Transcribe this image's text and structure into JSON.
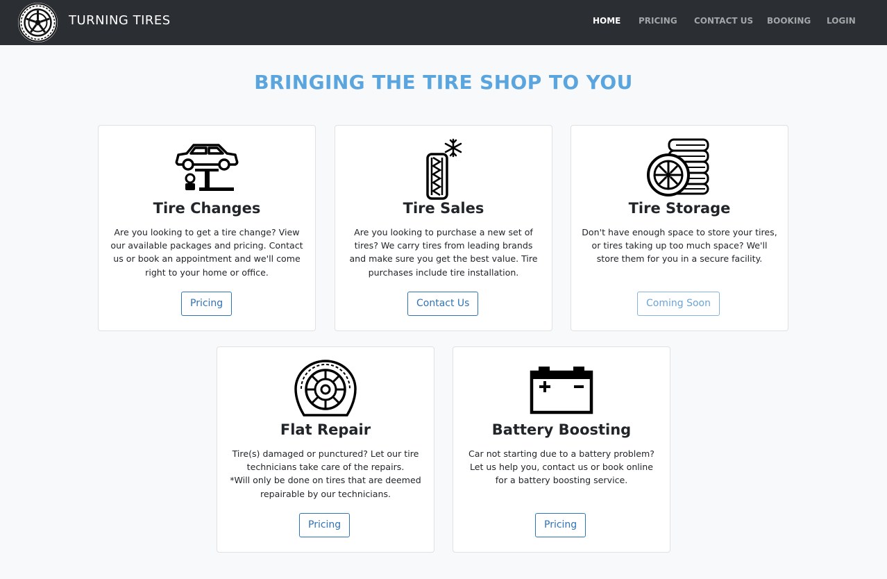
{
  "brand": {
    "name": "TURNING TIRES",
    "logo_icon": "tire-logo-icon"
  },
  "nav": {
    "items": [
      {
        "label": "HOME",
        "active": true
      },
      {
        "label": "PRICING",
        "active": false
      },
      {
        "label": "CONTACT US",
        "active": false
      },
      {
        "label": "BOOKING",
        "active": false
      },
      {
        "label": "LOGIN",
        "active": false
      }
    ]
  },
  "headline": "BRINGING THE TIRE SHOP TO YOU",
  "cards": [
    {
      "icon": "car-lift-icon",
      "title": "Tire Changes",
      "text": [
        "Are you looking to get a tire change? View our available packages and pricing. Contact us or book an appointment and we'll come right to your home or office."
      ],
      "button": "Pricing"
    },
    {
      "icon": "winter-tire-icon",
      "title": "Tire Sales",
      "text": [
        "Are you looking to purchase a new set of tires? We carry tires from leading brands and make sure you get the best value. Tire purchases include tire installation."
      ],
      "button": "Contact Us"
    },
    {
      "icon": "tire-stack-icon",
      "title": "Tire Storage",
      "text": [
        "Don't have enough space to store your tires, or tires taking up too much space? We'll store them for you in a secure facility."
      ],
      "button": "Coming Soon"
    },
    {
      "icon": "flat-tire-icon",
      "title": "Flat Repair",
      "text": [
        "Tire(s) damaged or punctured? Let our tire technicians take care of the repairs.",
        "*Will only be done on tires that are deemed repairable by our technicians."
      ],
      "button": "Pricing"
    },
    {
      "icon": "car-battery-icon",
      "title": "Battery Boosting",
      "text": [
        "Car not starting due to a battery problem? Let us help you, contact us or book online for a battery boosting service."
      ],
      "button": "Pricing"
    }
  ],
  "colors": {
    "navbar": "#2b2f33",
    "headline": "#5aa5de",
    "button": "#2f73b7",
    "page_bg": "#f8f9fa"
  }
}
